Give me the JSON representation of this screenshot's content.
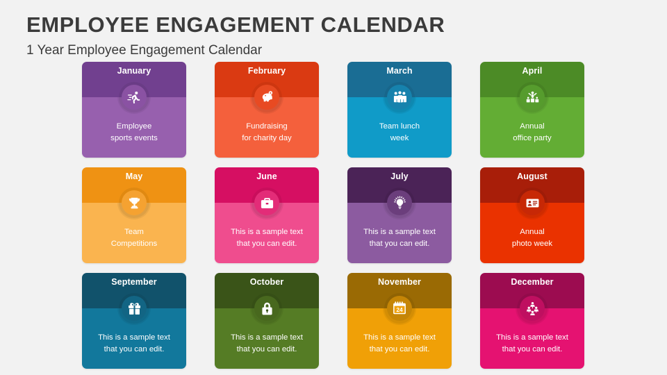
{
  "page": {
    "title": "EMPLOYEE ENGAGEMENT CALENDAR",
    "subtitle": "1 Year Employee Engagement Calendar",
    "background_color": "#f2f2f2",
    "title_color": "#3b3b3b"
  },
  "cards": [
    {
      "month": "January",
      "text": "Employee\nsports events",
      "icon": "running-person-icon",
      "header_color": "#71408f",
      "body_color": "#9760ae",
      "badge_color": "#8a52a3",
      "icon_color": "#ffffff"
    },
    {
      "month": "February",
      "text": "Fundraising\nfor charity day",
      "icon": "piggy-bank-icon",
      "header_color": "#da3a12",
      "body_color": "#f4603c",
      "badge_color": "#e84a22",
      "icon_color": "#ffffff"
    },
    {
      "month": "March",
      "text": "Team lunch\nweek",
      "icon": "group-people-icon",
      "header_color": "#1a6d94",
      "body_color": "#109bc8",
      "badge_color": "#1682ad",
      "icon_color": "#ffffff"
    },
    {
      "month": "April",
      "text": "Annual\noffice party",
      "icon": "celebration-presenter-icon",
      "header_color": "#4c8b26",
      "body_color": "#63ad34",
      "badge_color": "#569c2d",
      "icon_color": "#ffffff"
    },
    {
      "month": "May",
      "text": "Team\nCompetitions",
      "icon": "trophy-icon",
      "header_color": "#ef9213",
      "body_color": "#fab44f",
      "badge_color": "#f5a231",
      "icon_color": "#ffffff"
    },
    {
      "month": "June",
      "text": "This is a sample text\nthat you can edit.",
      "icon": "briefcase-icon",
      "header_color": "#d60f62",
      "body_color": "#ef4d8e",
      "badge_color": "#e32c78",
      "icon_color": "#ffffff"
    },
    {
      "month": "July",
      "text": "This is a sample text\nthat you can edit.",
      "icon": "lightbulb-idea-icon",
      "header_color": "#4b2357",
      "body_color": "#8c5ba0",
      "badge_color": "#6b3e7c",
      "icon_color": "#ffffff"
    },
    {
      "month": "August",
      "text": "Annual\nphoto week",
      "icon": "id-badge-icon",
      "header_color": "#a81e09",
      "body_color": "#ea3200",
      "badge_color": "#c72806",
      "icon_color": "#ffffff"
    },
    {
      "month": "September",
      "text": "This is a sample text\nthat you can edit.",
      "icon": "gift-icon",
      "header_color": "#11526b",
      "body_color": "#12789c",
      "badge_color": "#126584",
      "icon_color": "#ffffff"
    },
    {
      "month": "October",
      "text": "This is a sample text\nthat you can edit.",
      "icon": "padlock-icon",
      "header_color": "#3a5418",
      "body_color": "#557c25",
      "badge_color": "#48681e",
      "icon_color": "#ffffff"
    },
    {
      "month": "November",
      "text": "This is a sample text\nthat you can edit.",
      "icon": "calendar-24-icon",
      "header_color": "#9a6a04",
      "body_color": "#f0a007",
      "badge_color": "#c58506",
      "icon_color": "#ffffff",
      "icon_label": "24"
    },
    {
      "month": "December",
      "text": "This is a sample text\nthat you can edit.",
      "icon": "team-group-icon",
      "header_color": "#9c0c50",
      "body_color": "#e51271",
      "badge_color": "#bf0f60",
      "icon_color": "#ffffff"
    }
  ]
}
